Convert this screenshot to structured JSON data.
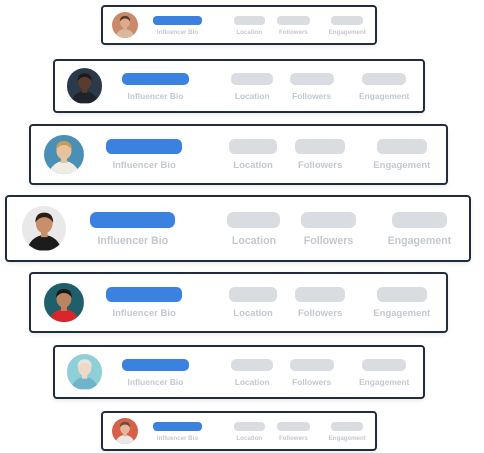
{
  "columns": {
    "bio": "Influencer Bio",
    "location": "Location",
    "followers": "Followers",
    "engagement": "Engagement"
  },
  "rows": [
    {
      "avatar": "person-avatar-1",
      "palette": {
        "bg": "#c98a6a",
        "skin": "#e0a98a",
        "hair": "#5a3a2a",
        "shirt": "#d9b8a0"
      }
    },
    {
      "avatar": "person-avatar-2",
      "palette": {
        "bg": "#2b3a4a",
        "skin": "#5a3b2c",
        "hair": "#1a1a1a",
        "shirt": "#20242a"
      }
    },
    {
      "avatar": "person-avatar-3",
      "palette": {
        "bg": "#4a8fb5",
        "skin": "#e8c29a",
        "hair": "#c99a5a",
        "shirt": "#f0ece4"
      }
    },
    {
      "avatar": "person-avatar-4",
      "palette": {
        "bg": "#e9e9e9",
        "skin": "#c98f6c",
        "hair": "#2a1f18",
        "shirt": "#1c1c1c"
      }
    },
    {
      "avatar": "person-avatar-5",
      "palette": {
        "bg": "#1f5f6a",
        "skin": "#b98460",
        "hair": "#1a1a1a",
        "shirt": "#d8262a"
      }
    },
    {
      "avatar": "person-avatar-6",
      "palette": {
        "bg": "#8fcfd8",
        "skin": "#f0d8c8",
        "hair": "#e9e4dc",
        "shirt": "#6fb4c8"
      }
    },
    {
      "avatar": "person-avatar-7",
      "palette": {
        "bg": "#d6604a",
        "skin": "#e6b496",
        "hair": "#6a4a38",
        "shirt": "#e8e8e8"
      }
    }
  ]
}
